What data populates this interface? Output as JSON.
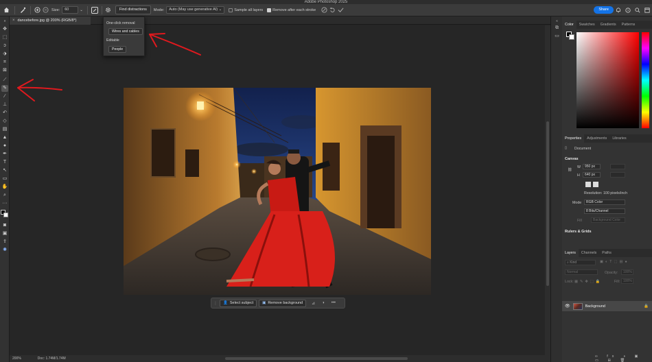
{
  "app": {
    "title": "Adobe Photoshop 2025"
  },
  "options_bar": {
    "size_label": "Size:",
    "size_value": "60",
    "find_distractions_label": "Find distractions",
    "mode_label": "Mode:",
    "mode_value": "Auto (May use generative AI)",
    "sample_all_layers_label": "Sample all layers",
    "sample_all_layers_checked": false,
    "remove_after_stroke_label": "Remove after each stroke",
    "remove_after_stroke_checked": true,
    "share_label": "Share"
  },
  "find_distractions_menu": {
    "one_click_header": "One-click removal",
    "wires_label": "Wires and cables",
    "editable_header": "Editable",
    "people_label": "People"
  },
  "document": {
    "tab_title": "dancebefore.jpg @ 200% (RGB/8*)"
  },
  "contextual_task_bar": {
    "select_subject_label": "Select subject",
    "remove_background_label": "Remove background",
    "more_label": "•••"
  },
  "status_bar": {
    "zoom": "200%",
    "doc_info": "Doc: 1.74M/1.74M"
  },
  "color_panel": {
    "tabs": [
      "Color",
      "Swatches",
      "Gradients",
      "Patterns"
    ],
    "foreground": "#000000",
    "background": "#ffffff"
  },
  "properties_panel": {
    "tabs": [
      "Properties",
      "Adjustments",
      "Libraries"
    ],
    "document_label": "Document",
    "canvas_header": "Canvas",
    "w_label": "W",
    "w_value": "950 px",
    "h_label": "H",
    "h_value": "640 px",
    "resolution": "Resolution: 100 pixels/inch",
    "mode_label": "Mode",
    "mode_value": "RGB Color",
    "bits_value": "8 Bits/Channel",
    "fill_label": "Fill",
    "fill_value": "Background Color",
    "rulers_header": "Rulers & Grids"
  },
  "layers_panel": {
    "tabs": [
      "Layers",
      "Channels",
      "Paths"
    ],
    "kind_placeholder": "Kind",
    "blend_mode": "Normal",
    "opacity_label": "Opacity:",
    "opacity_value": "100%",
    "lock_label": "Lock:",
    "fill_label": "Fill:",
    "fill_value": "100%",
    "layer_name": "Background"
  }
}
